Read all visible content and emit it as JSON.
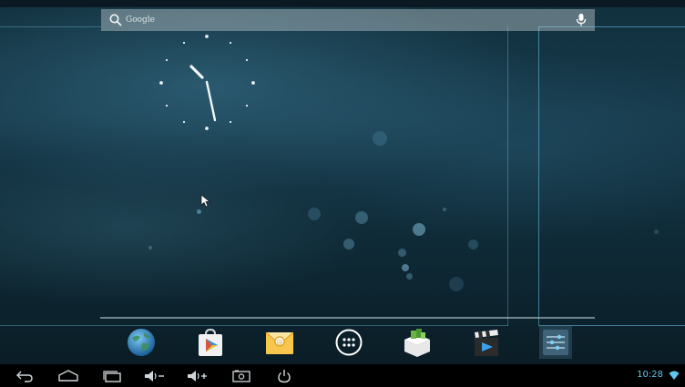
{
  "search": {
    "placeholder": "Google",
    "search_icon": "search-icon",
    "mic_icon": "mic-icon"
  },
  "clock_widget": {
    "type": "analog-clock",
    "hour": 10,
    "minute": 28
  },
  "dock": {
    "apps": [
      {
        "name": "browser",
        "icon": "globe-icon"
      },
      {
        "name": "play-store",
        "icon": "shopping-bag-play-icon"
      },
      {
        "name": "email",
        "icon": "envelope-icon"
      },
      {
        "name": "all-apps",
        "icon": "app-drawer-icon"
      },
      {
        "name": "file-manager",
        "icon": "file-box-icon"
      },
      {
        "name": "video-player",
        "icon": "clapperboard-icon"
      },
      {
        "name": "settings",
        "icon": "sliders-icon"
      }
    ]
  },
  "navbar": {
    "buttons": [
      "back-icon",
      "home-icon",
      "recent-apps-icon",
      "volume-down-icon",
      "volume-up-icon",
      "screenshot-icon",
      "power-icon"
    ],
    "time": "10:28",
    "status_icon": "wifi-icon",
    "accent_color": "#5fc7f0"
  }
}
